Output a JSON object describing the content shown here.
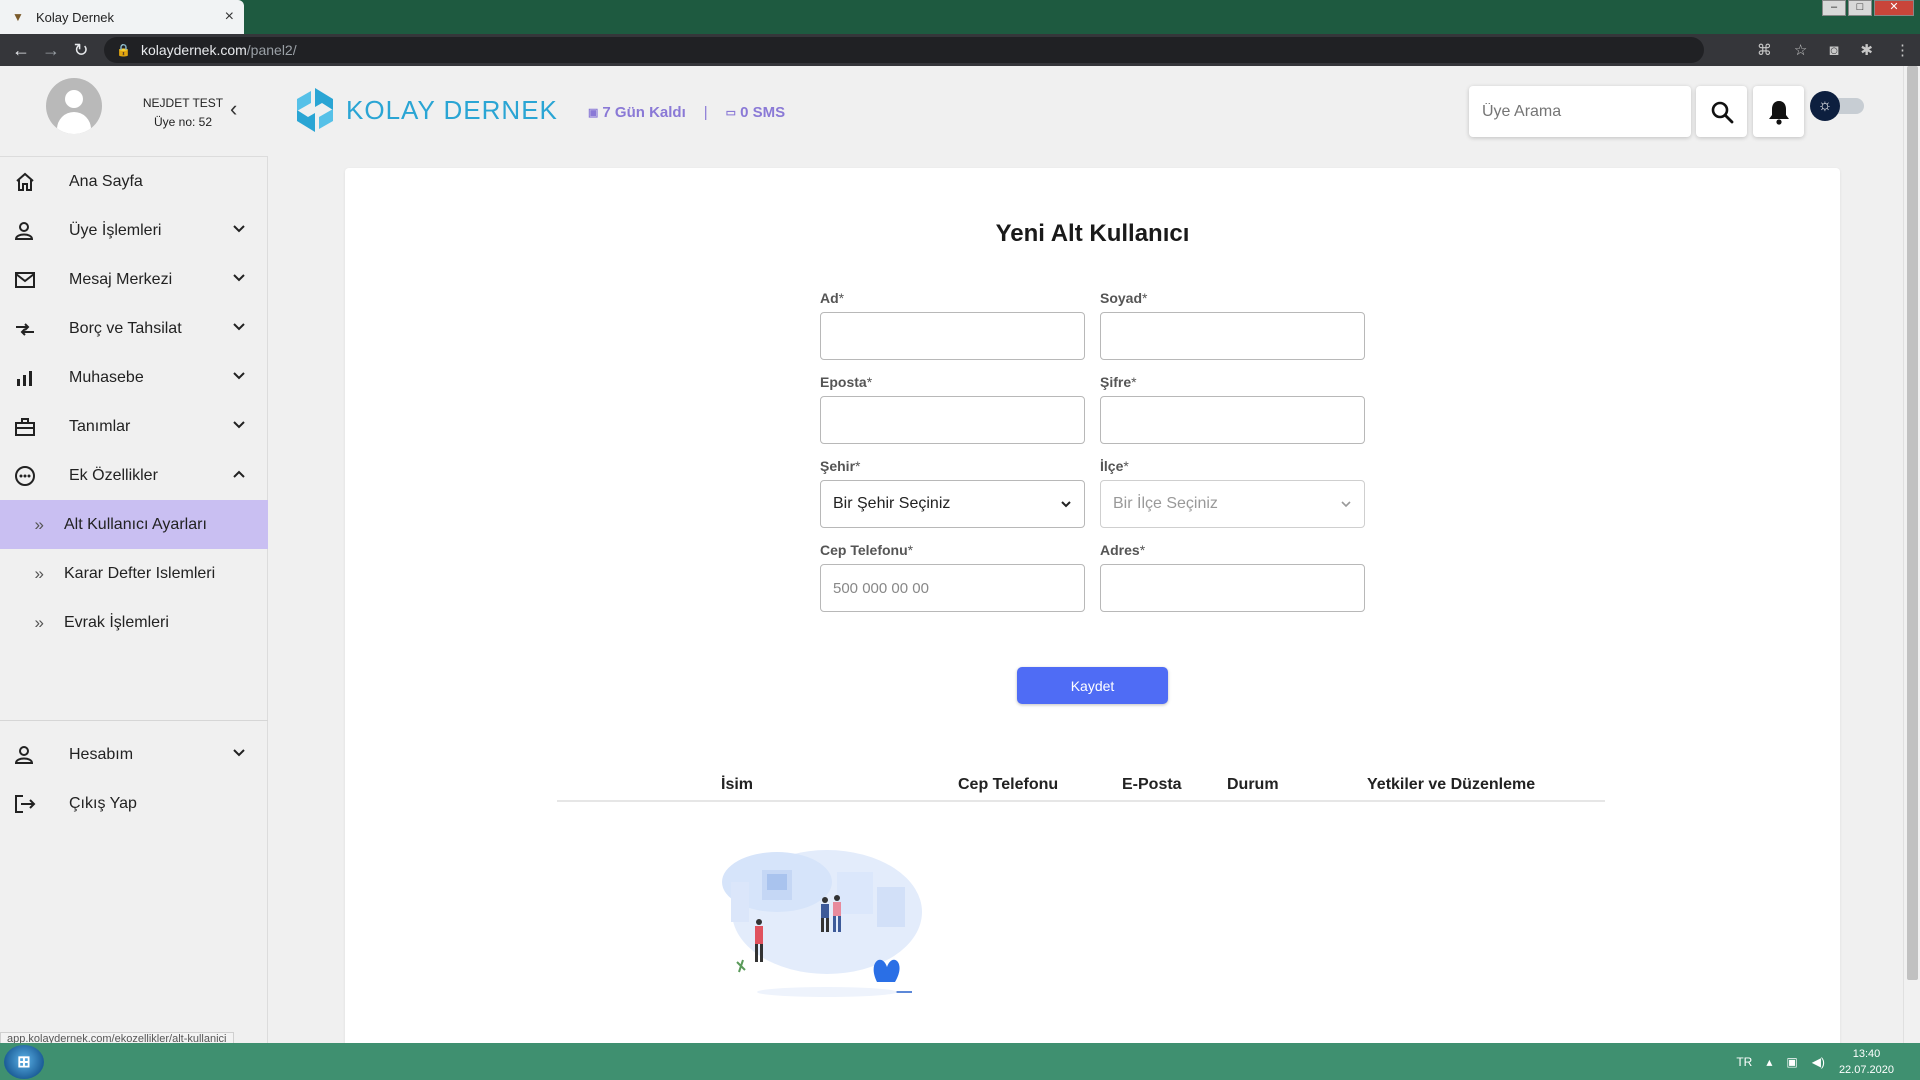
{
  "browser": {
    "tab_title": "Kolay Dernek",
    "tab_close": "×",
    "url_host": "kolaydernek.com",
    "url_path": "/panel2/"
  },
  "header": {
    "user_name": "NEJDET TEST",
    "member_no": "Üye no: 52",
    "brand": "KOLAY DERNEK",
    "days_left": "7 Gün Kaldı",
    "separator": "|",
    "sms": "0 SMS",
    "search_placeholder": "Üye Arama"
  },
  "sidebar": {
    "items": [
      {
        "label": "Ana Sayfa"
      },
      {
        "label": "Üye İşlemleri"
      },
      {
        "label": "Mesaj Merkezi"
      },
      {
        "label": "Borç ve Tahsilat"
      },
      {
        "label": "Muhasebe"
      },
      {
        "label": "Tanımlar"
      },
      {
        "label": "Ek Özellikler"
      }
    ],
    "subitems": [
      {
        "label": "Alt Kullanıcı Ayarları"
      },
      {
        "label": "Karar Defter Islemleri"
      },
      {
        "label": "Evrak İşlemleri"
      }
    ],
    "bottom": [
      {
        "label": "Hesabım"
      },
      {
        "label": "Çıkış Yap"
      }
    ],
    "subitem_marker": "»",
    "status_url": "app.kolaydernek.com/ekozellikler/alt-kullanici"
  },
  "form": {
    "title": "Yeni Alt Kullanıcı",
    "required_mark": "*",
    "fields": {
      "ad": {
        "label": "Ad",
        "value": ""
      },
      "soyad": {
        "label": "Soyad",
        "value": ""
      },
      "eposta": {
        "label": "Eposta",
        "value": ""
      },
      "sifre": {
        "label": "Şifre",
        "value": ""
      },
      "sehir": {
        "label": "Şehir",
        "selected": "Bir Şehir Seçiniz"
      },
      "ilce": {
        "label": "İlçe",
        "selected": "Bir İlçe Seçiniz"
      },
      "telefon": {
        "label": "Cep Telefonu",
        "placeholder": "500 000 00 00"
      },
      "adres": {
        "label": "Adres",
        "value": ""
      }
    },
    "save_label": "Kaydet"
  },
  "table": {
    "columns": [
      "İsim",
      "Cep Telefonu",
      "E-Posta",
      "Durum",
      "Yetkiler ve Düzenleme"
    ]
  },
  "taskbar": {
    "lang": "TR",
    "time": "13:40",
    "date": "22.07.2020"
  },
  "colors": {
    "accent_purple": "#8a79d6",
    "active_menu_bg": "#c9bff2",
    "save_button": "#4f6cf5",
    "brand_blue": "#2aa5d4",
    "taskbar": "#3f9070"
  }
}
